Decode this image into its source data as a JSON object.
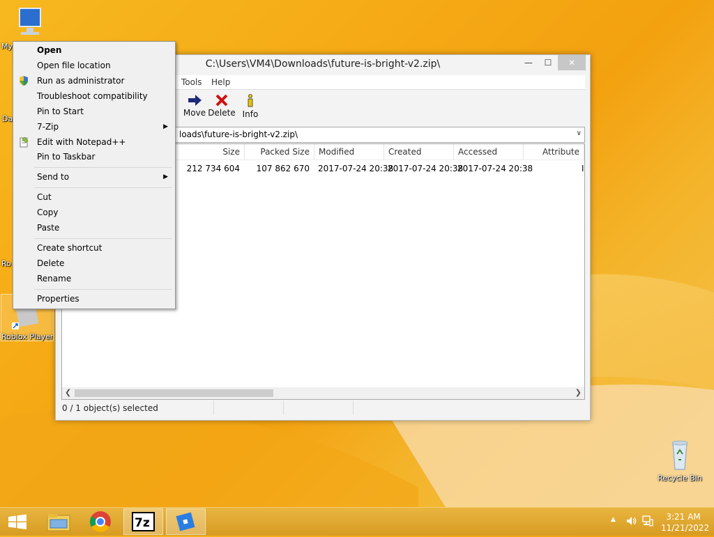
{
  "desktop": {
    "icons": [
      {
        "label": "My",
        "icon": "computer-icon"
      },
      {
        "label": "Da",
        "icon": "app-icon"
      },
      {
        "label": "Ro",
        "icon": "app-icon"
      },
      {
        "label": "Roblox Player",
        "icon": "roblox-icon"
      },
      {
        "label": "Recycle Bin",
        "icon": "recycle-bin-icon"
      }
    ]
  },
  "window": {
    "title": "C:\\Users\\VM4\\Downloads\\future-is-bright-v2.zip\\",
    "controls": {
      "minimize": "—",
      "maximize": "☐",
      "close": "✕"
    },
    "menu": [
      "Tools",
      "Help"
    ],
    "toolbar": [
      {
        "label": "Move",
        "icon": "move-arrow-icon",
        "color": "#1f2a7a"
      },
      {
        "label": "Delete",
        "icon": "delete-x-icon",
        "color": "#d01010"
      },
      {
        "label": "Info",
        "icon": "info-icon",
        "color": "#e8c400"
      }
    ],
    "address": "loads\\future-is-bright-v2.zip\\",
    "columns": [
      "Size",
      "Packed Size",
      "Modified",
      "Created",
      "Accessed",
      "Attribute"
    ],
    "rows": [
      {
        "size": "212 734 604",
        "packed": "107 862 670",
        "modified": "2017-07-24 20:38",
        "created": "2017-07-24 20:38",
        "accessed": "2017-07-24 20:38",
        "attr": "I"
      }
    ],
    "status": "0 / 1 object(s) selected"
  },
  "context_menu": {
    "items": [
      {
        "label": "Open",
        "bold": true
      },
      {
        "label": "Open file location"
      },
      {
        "label": "Run as administrator",
        "icon": "shield-icon"
      },
      {
        "label": "Troubleshoot compatibility"
      },
      {
        "label": "Pin to Start"
      },
      {
        "label": "7-Zip",
        "submenu": true
      },
      {
        "label": "Edit with Notepad++",
        "icon": "notepad-plus-icon"
      },
      {
        "label": "Pin to Taskbar"
      },
      {
        "label": "Send to",
        "submenu": true
      },
      {
        "label": "Cut"
      },
      {
        "label": "Copy"
      },
      {
        "label": "Paste"
      },
      {
        "label": "Create shortcut"
      },
      {
        "label": "Delete"
      },
      {
        "label": "Rename"
      },
      {
        "label": "Properties"
      }
    ]
  },
  "taskbar": {
    "apps": [
      "start-icon",
      "file-explorer-icon",
      "chrome-icon",
      "7zip-icon",
      "roblox-icon"
    ],
    "time": "3:21 AM",
    "date": "11/21/2022",
    "tray": [
      "show-hidden-icons-icon",
      "volume-icon",
      "network-icon"
    ]
  }
}
